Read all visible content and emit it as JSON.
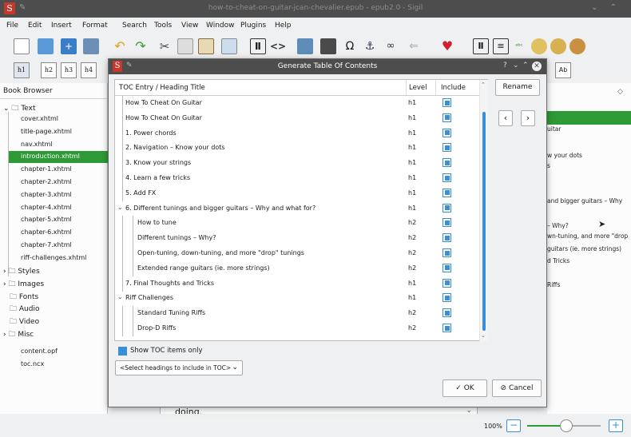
{
  "window": {
    "title": "how-to-cheat-on-guitar-jcan-chevalier.epub - epub2.0 - Sigil"
  },
  "menu": [
    "File",
    "Edit",
    "Insert",
    "Format",
    "Search",
    "Tools",
    "View",
    "Window",
    "Plugins",
    "Help"
  ],
  "heading_buttons": [
    "h1",
    "h2",
    "h3",
    "h4"
  ],
  "book_browser": {
    "title": "Book Browser",
    "text_folder": "Text",
    "files": [
      "cover.xhtml",
      "title-page.xhtml",
      "nav.xhtml",
      "introduction.xhtml",
      "chapter-1.xhtml",
      "chapter-2.xhtml",
      "chapter-3.xhtml",
      "chapter-4.xhtml",
      "chapter-5.xhtml",
      "chapter-6.xhtml",
      "chapter-7.xhtml",
      "riff-challenges.xhtml"
    ],
    "selected": "introduction.xhtml",
    "folders": [
      "Styles",
      "Images",
      "Fonts",
      "Audio",
      "Video",
      "Misc"
    ],
    "root_files": [
      "content.opf",
      "toc.ncx"
    ]
  },
  "right_panel": {
    "lines": [
      "uitar",
      "w your dots",
      "s",
      "and bigger guitars – Why",
      "– Why?",
      "wn-tuning, and more \"drop",
      "guitars (ie. more strings)",
      "d Tricks",
      "Riffs"
    ],
    "ab_label": "Ab"
  },
  "editor": {
    "text": "doing."
  },
  "status": {
    "zoom": "100%"
  },
  "dialog": {
    "title": "Generate Table Of Contents",
    "columns": {
      "entry": "TOC Entry / Heading Title",
      "level": "Level",
      "include": "Include"
    },
    "rows": [
      {
        "title": "How To Cheat On Guitar",
        "level": "h1",
        "indent": 0,
        "include": true
      },
      {
        "title": "How To Cheat On Guitar",
        "level": "h1",
        "indent": 0,
        "include": true
      },
      {
        "title": "1. Power chords",
        "level": "h1",
        "indent": 0,
        "include": true
      },
      {
        "title": "2. Navigation – Know your dots",
        "level": "h1",
        "indent": 0,
        "include": true
      },
      {
        "title": "3. Know your strings",
        "level": "h1",
        "indent": 0,
        "include": true
      },
      {
        "title": "4. Learn a few tricks",
        "level": "h1",
        "indent": 0,
        "include": true
      },
      {
        "title": "5. Add FX",
        "level": "h1",
        "indent": 0,
        "include": true
      },
      {
        "title": "6. Different tunings and bigger guitars – Why and what for?",
        "level": "h1",
        "indent": 0,
        "include": true,
        "expanded": true
      },
      {
        "title": "How to tune",
        "level": "h2",
        "indent": 1,
        "include": true
      },
      {
        "title": "Different tunings – Why?",
        "level": "h2",
        "indent": 1,
        "include": true
      },
      {
        "title": "Open-tuning, down-tuning, and more \"drop\" tunings",
        "level": "h2",
        "indent": 1,
        "include": true
      },
      {
        "title": "Extended range guitars (ie. more strings)",
        "level": "h2",
        "indent": 1,
        "include": true
      },
      {
        "title": "7. Final Thoughts and Tricks",
        "level": "h1",
        "indent": 0,
        "include": true
      },
      {
        "title": "Riff Challenges",
        "level": "h1",
        "indent": 0,
        "include": true,
        "expanded": true
      },
      {
        "title": "Standard Tuning Riffs",
        "level": "h2",
        "indent": 1,
        "include": true
      },
      {
        "title": "Drop-D Riffs",
        "level": "h2",
        "indent": 1,
        "include": true
      }
    ],
    "rename": "Rename",
    "show_toc_only": "Show TOC items only",
    "select_headings": "<Select headings to include in TOC>",
    "ok": "OK",
    "cancel": "Cancel",
    "title_controls": "?"
  },
  "colors": {
    "accent": "#3a8ed8",
    "selection": "#2e9a35",
    "titlebar": "#4d4d4d"
  }
}
